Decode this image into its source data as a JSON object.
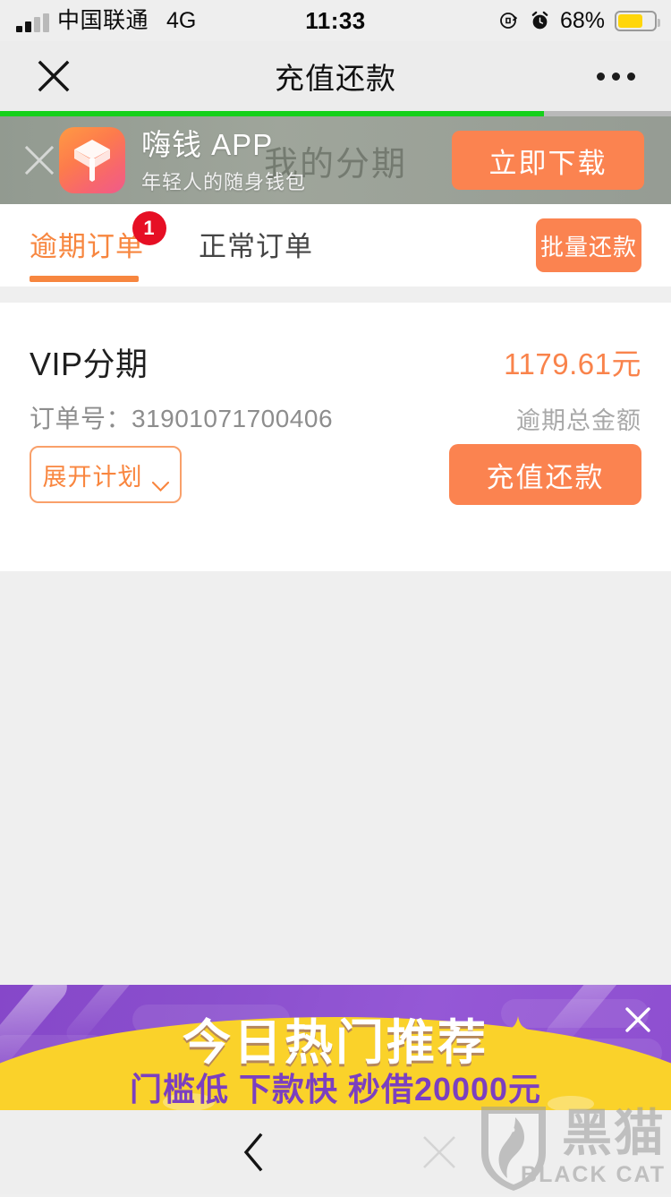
{
  "statusbar": {
    "carrier": "中国联通",
    "network": "4G",
    "time": "11:33",
    "battery_pct": "68%",
    "icons": [
      "signal-bars-icon",
      "rotation-lock-icon",
      "alarm-clock-icon",
      "battery-icon"
    ],
    "battery_level": 68,
    "battery_color": "#ffd60a"
  },
  "navbar": {
    "close_label": "×",
    "title": "充值还款",
    "more_label": "•••"
  },
  "progress": {
    "percent": 81,
    "color": "#15d01a"
  },
  "page_header": {
    "title": "我的分期"
  },
  "app_banner": {
    "close_label": "×",
    "app_name": "嗨钱 APP",
    "app_slogan": "年轻人的随身钱包",
    "download_label": "立即下载",
    "button_color": "#fb8350"
  },
  "tabs": {
    "items": [
      {
        "label": "逾期订单",
        "active": true,
        "badge": "1"
      },
      {
        "label": "正常订单",
        "active": false,
        "badge": ""
      }
    ],
    "batch_repay_label": "批量还款",
    "active_color": "#f7863f",
    "inactive_color": "#454545",
    "badge_color": "#e60f24"
  },
  "order": {
    "product_name": "VIP分期",
    "order_no_label": "订单号：",
    "order_no": "31901071700406",
    "amount": "1179.61元",
    "amount_label": "逾期总金额",
    "amount_color": "#f9834b",
    "expand_plan_label": "展开计划",
    "repay_label": "充值还款"
  },
  "ad_banner": {
    "title": "今日热门推荐",
    "subtitle": "门槛低 下款快 秒借20000元",
    "close_label": "×",
    "bg_color": "#8e4fd0",
    "band_color": "#fad22a",
    "subtitle_color": "#7b3fc0"
  },
  "bottombar": {
    "back_label": "‹"
  },
  "watermark": {
    "cn": "黑猫",
    "en": "BLACK CAT"
  }
}
